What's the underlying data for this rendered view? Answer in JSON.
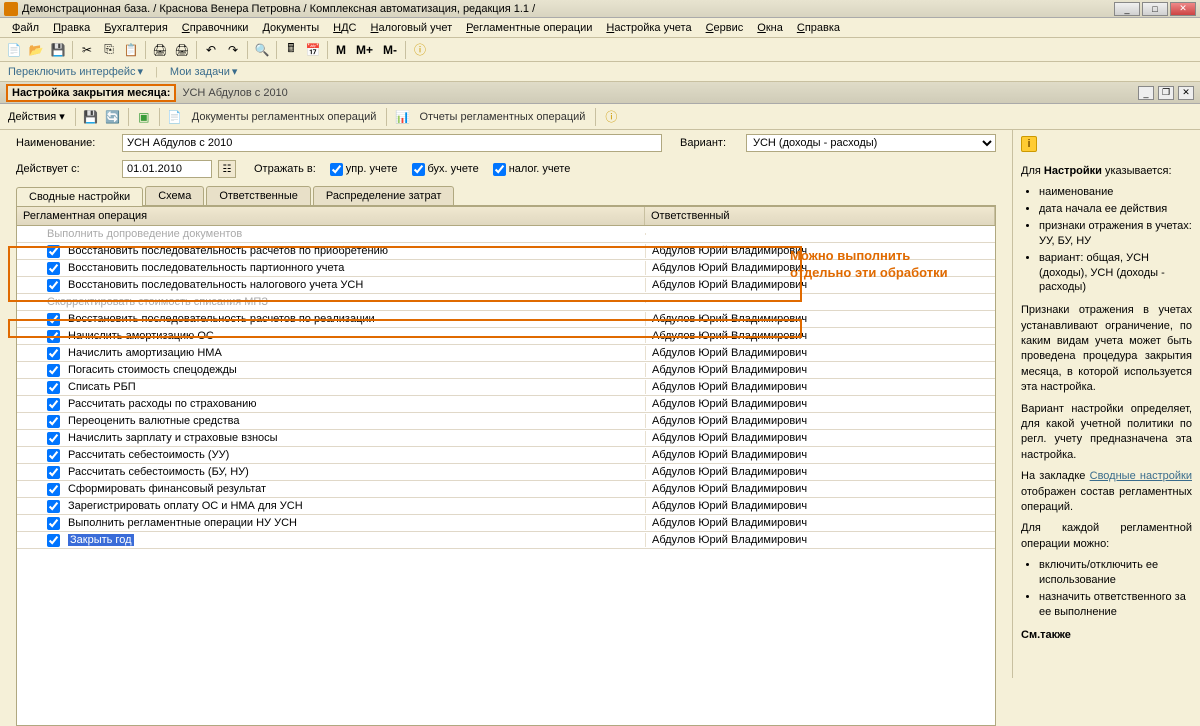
{
  "window_title": "Демонстрационная база. / Краснова Венера Петровна / Комплексная автоматизация, редакция 1.1 /",
  "menu": [
    "Файл",
    "Правка",
    "Бухгалтерия",
    "Справочники",
    "Документы",
    "НДС",
    "Налоговый учет",
    "Регламентные операции",
    "Настройка учета",
    "Сервис",
    "Окна",
    "Справка"
  ],
  "secondbar": {
    "switch": "Переключить интерфейс",
    "tasks": "Мои задачи"
  },
  "tabheader": {
    "label": "Настройка закрытия месяца:",
    "title": "УСН Абдулов с 2010"
  },
  "actionbar": {
    "actions": "Действия",
    "docs": "Документы регламентных операций",
    "reports": "Отчеты регламентных операций"
  },
  "form": {
    "name_label": "Наименование:",
    "name_value": "УСН Абдулов с 2010",
    "variant_label": "Вариант:",
    "variant_value": "УСН (доходы - расходы)",
    "effective_label": "Действует с:",
    "effective_value": "01.01.2010",
    "reflect_label": "Отражать в:",
    "chk1": "упр. учете",
    "chk2": "бух. учете",
    "chk3": "налог. учете"
  },
  "tabs": [
    "Сводные настройки",
    "Схема",
    "Ответственные",
    "Распределение затрат"
  ],
  "grid": {
    "col_op": "Регламентная операция",
    "col_resp": "Ответственный",
    "rows": [
      {
        "greyed": true,
        "nocheck": true,
        "op": "Выполнить допроведение документов",
        "resp": ""
      },
      {
        "op": "Восстановить последовательность расчетов по приобретению",
        "resp": "Абдулов Юрий Владимирович"
      },
      {
        "op": "Восстановить последовательность партионного учета",
        "resp": "Абдулов Юрий Владимирович"
      },
      {
        "op": "Восстановить последовательность налогового учета УСН",
        "resp": "Абдулов Юрий Владимирович"
      },
      {
        "greyed": true,
        "nocheck": true,
        "op": "Скорректировать стоимость списания МПЗ",
        "resp": ""
      },
      {
        "op": "Восстановить последовательность расчетов по реализации",
        "resp": "Абдулов Юрий Владимирович"
      },
      {
        "op": "Начислить амортизацию ОС",
        "resp": "Абдулов Юрий Владимирович"
      },
      {
        "op": "Начислить амортизацию НМА",
        "resp": "Абдулов Юрий Владимирович"
      },
      {
        "op": "Погасить стоимость спецодежды",
        "resp": "Абдулов Юрий Владимирович"
      },
      {
        "op": "Списать РБП",
        "resp": "Абдулов Юрий Владимирович"
      },
      {
        "op": "Рассчитать расходы по страхованию",
        "resp": "Абдулов Юрий Владимирович"
      },
      {
        "op": "Переоценить валютные средства",
        "resp": "Абдулов Юрий Владимирович"
      },
      {
        "op": "Начислить зарплату и страховые взносы",
        "resp": "Абдулов Юрий Владимирович"
      },
      {
        "op": "Рассчитать себестоимость (УУ)",
        "resp": "Абдулов Юрий Владимирович"
      },
      {
        "op": "Рассчитать себестоимость (БУ, НУ)",
        "resp": "Абдулов Юрий Владимирович"
      },
      {
        "op": "Сформировать финансовый результат",
        "resp": "Абдулов Юрий Владимирович"
      },
      {
        "op": "Зарегистрировать оплату ОС и НМА для УСН",
        "resp": "Абдулов Юрий Владимирович"
      },
      {
        "op": "Выполнить регламентные операции НУ УСН",
        "resp": "Абдулов Юрий Владимирович"
      },
      {
        "sel": true,
        "op": "Закрыть год",
        "resp": "Абдулов Юрий Владимирович"
      }
    ]
  },
  "annotation": "Можно выполнить отдельно эти обработки",
  "help": {
    "intro": "Для Настройки указывается:",
    "bullets1": [
      "наименование",
      "дата начала ее действия",
      "признаки отражения в учетах: УУ, БУ, НУ",
      "вариант: общая, УСН (доходы), УСН (доходы - расходы)"
    ],
    "p1": "Признаки отражения в учетах устанавливают ограничение, по каким видам учета может быть проведена процедура закрытия месяца, в которой используется эта настройка.",
    "p2": "Вариант настройки определяет, для какой учетной политики по регл. учету предназначена эта настройка.",
    "p3a": "На закладке ",
    "p3link": "Сводные настройки",
    "p3b": " отображен состав регламентных операций.",
    "p4": "Для каждой регламентной операции можно:",
    "bullets2": [
      "включить/отключить ее использование",
      "назначить ответственного за ее выполнение"
    ],
    "seealso": "См.также"
  }
}
